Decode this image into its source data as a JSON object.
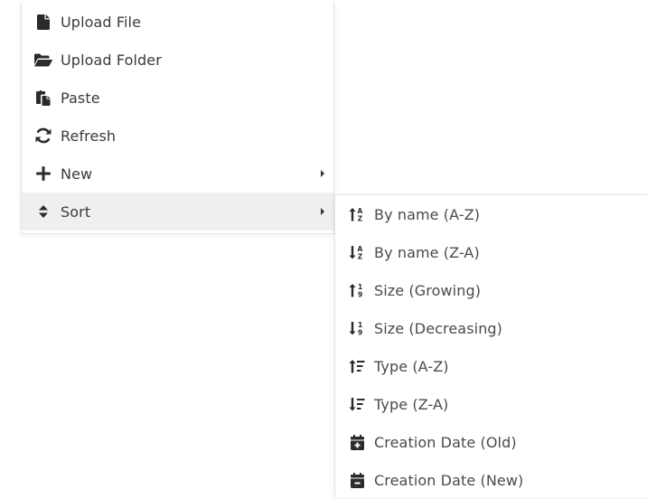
{
  "main_menu": {
    "items": [
      {
        "label": "Upload File",
        "icon": "file-icon"
      },
      {
        "label": "Upload Folder",
        "icon": "folder-open-icon"
      },
      {
        "label": "Paste",
        "icon": "paste-icon"
      },
      {
        "label": "Refresh",
        "icon": "refresh-icon"
      },
      {
        "label": "New",
        "icon": "plus-icon",
        "has_submenu": true
      },
      {
        "label": "Sort",
        "icon": "sort-icon",
        "has_submenu": true,
        "active": true
      }
    ]
  },
  "sort_submenu": {
    "items": [
      {
        "label": "By name (A-Z)",
        "icon": "sort-alpha-asc-icon"
      },
      {
        "label": "By name (Z-A)",
        "icon": "sort-alpha-desc-icon"
      },
      {
        "label": "Size (Growing)",
        "icon": "sort-numeric-asc-icon"
      },
      {
        "label": "Size (Decreasing)",
        "icon": "sort-numeric-desc-icon"
      },
      {
        "label": "Type (A-Z)",
        "icon": "sort-amount-asc-icon"
      },
      {
        "label": "Type (Z-A)",
        "icon": "sort-amount-desc-icon"
      },
      {
        "label": "Creation Date (Old)",
        "icon": "calendar-plus-icon"
      },
      {
        "label": "Creation Date (New)",
        "icon": "calendar-minus-icon"
      }
    ]
  },
  "colors": {
    "text": "#3a3a3a",
    "icon": "#2b2b2b",
    "active_background": "#efefef",
    "border": "#e3e3e3"
  }
}
